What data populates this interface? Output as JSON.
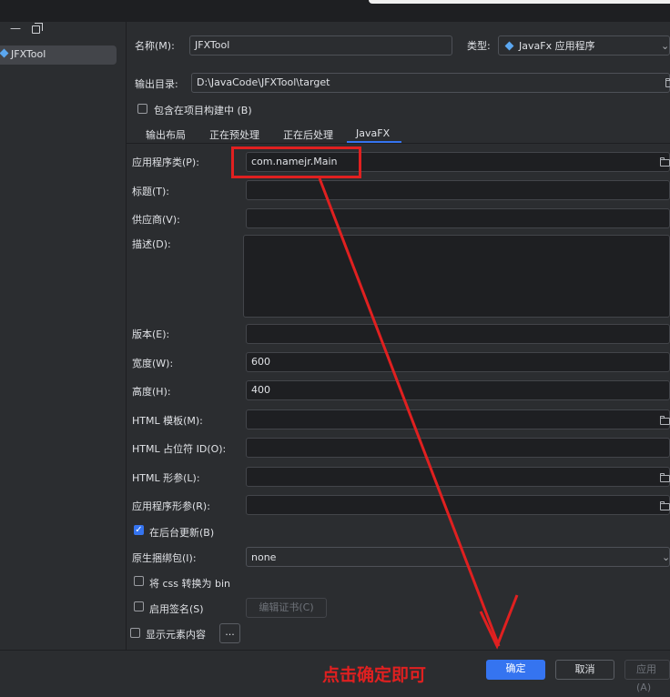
{
  "colors": {
    "accent": "#3574f0",
    "annotation": "#e02020",
    "background": "#2b2d30",
    "field_bg": "#1e1f22"
  },
  "toolbar": {
    "collapse_icon": "minus-icon",
    "copy_icon": "copy-icon"
  },
  "tree": {
    "item_label": "JFXTool",
    "item_icon": "javafx-icon"
  },
  "header": {
    "name_label": "名称(M):",
    "name_value": "JFXTool",
    "type_label": "类型:",
    "type_value": "JavaFx 应用程序",
    "output_dir_label": "输出目录:",
    "output_dir_value": "D:\\JavaCode\\JFXTool\\target",
    "include_in_build_label": "包含在项目构建中 (B)"
  },
  "tabs": [
    {
      "label": "输出布局",
      "active": false
    },
    {
      "label": "正在预处理",
      "active": false
    },
    {
      "label": "正在后处理",
      "active": false
    },
    {
      "label": "JavaFX",
      "active": true
    }
  ],
  "form": {
    "app_class_label": "应用程序类(P):",
    "app_class_value": "com.namejr.Main",
    "title_label": "标题(T):",
    "title_value": "",
    "vendor_label": "供应商(V):",
    "vendor_value": "",
    "description_label": "描述(D):",
    "description_value": "",
    "version_label": "版本(E):",
    "version_value": "",
    "width_label": "宽度(W):",
    "width_value": "600",
    "height_label": "高度(H):",
    "height_value": "400",
    "html_template_label": "HTML 模板(M):",
    "html_template_value": "",
    "html_placeholder_label": "HTML 占位符 ID(O):",
    "html_placeholder_value": "",
    "html_params_label": "HTML 形参(L):",
    "html_params_value": "",
    "app_params_label": "应用程序形参(R):",
    "app_params_value": "",
    "update_background_label": "在后台更新(B)",
    "update_background_checked": true,
    "native_bundle_label": "原生捆绑包(I):",
    "native_bundle_value": "none",
    "convert_css_label": "将 css 转换为 bin",
    "convert_css_checked": false,
    "enable_signing_label": "启用签名(S)",
    "enable_signing_checked": false,
    "edit_cert_label": "编辑证书(C)",
    "show_elements_label": "显示元素内容",
    "more_label": "..."
  },
  "footer": {
    "ok_label": "确定",
    "cancel_label": "取消",
    "apply_label": "应用(A)"
  },
  "annotation": {
    "text": "点击确定即可"
  }
}
